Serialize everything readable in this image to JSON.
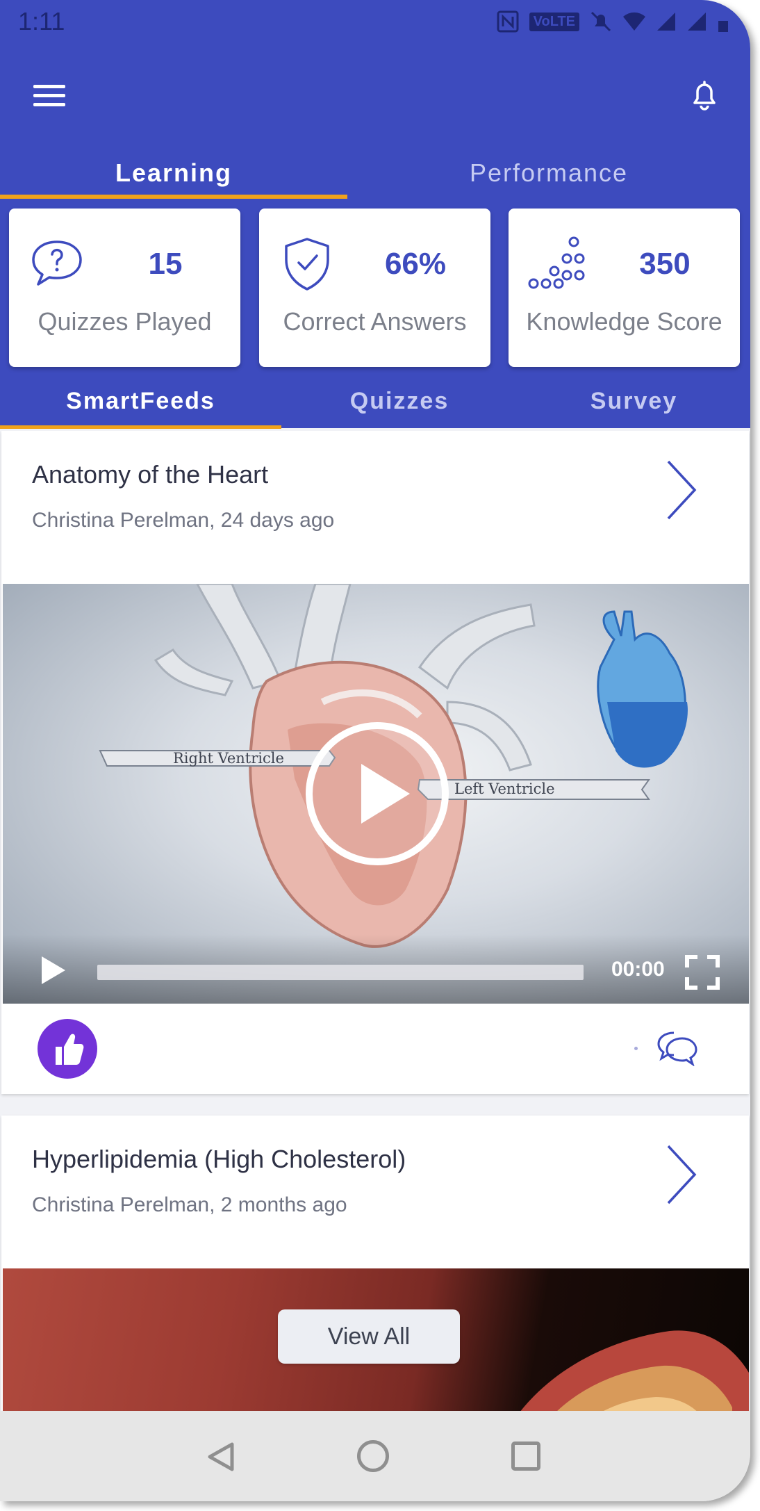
{
  "status_bar": {
    "time": "1:11",
    "volte": "VoLTE"
  },
  "top_tabs": [
    {
      "label": "Learning",
      "active": true
    },
    {
      "label": "Performance",
      "active": false
    }
  ],
  "stats": [
    {
      "value": "15",
      "label": "Quizzes Played",
      "icon": "speech-question-icon"
    },
    {
      "value": "66%",
      "label": "Correct Answers",
      "icon": "shield-check-icon"
    },
    {
      "value": "350",
      "label": "Knowledge Score",
      "icon": "dots-pyramid-icon"
    }
  ],
  "sub_tabs": [
    {
      "label": "SmartFeeds",
      "active": true
    },
    {
      "label": "Quizzes",
      "active": false
    },
    {
      "label": "Survey",
      "active": false
    }
  ],
  "posts": [
    {
      "title": "Anatomy of the Heart",
      "meta": "Christina Perelman, 24 days ago",
      "video": {
        "label_right": "Right Ventricle",
        "label_left": "Left Ventricle",
        "time": "00:00"
      }
    },
    {
      "title": "Hyperlipidemia (High Cholesterol)",
      "meta": "Christina Perelman, 2 months ago"
    }
  ],
  "view_all_label": "View All",
  "colors": {
    "primary": "#3d4bbe",
    "accent": "#f0a21c",
    "like": "#7333d8"
  }
}
